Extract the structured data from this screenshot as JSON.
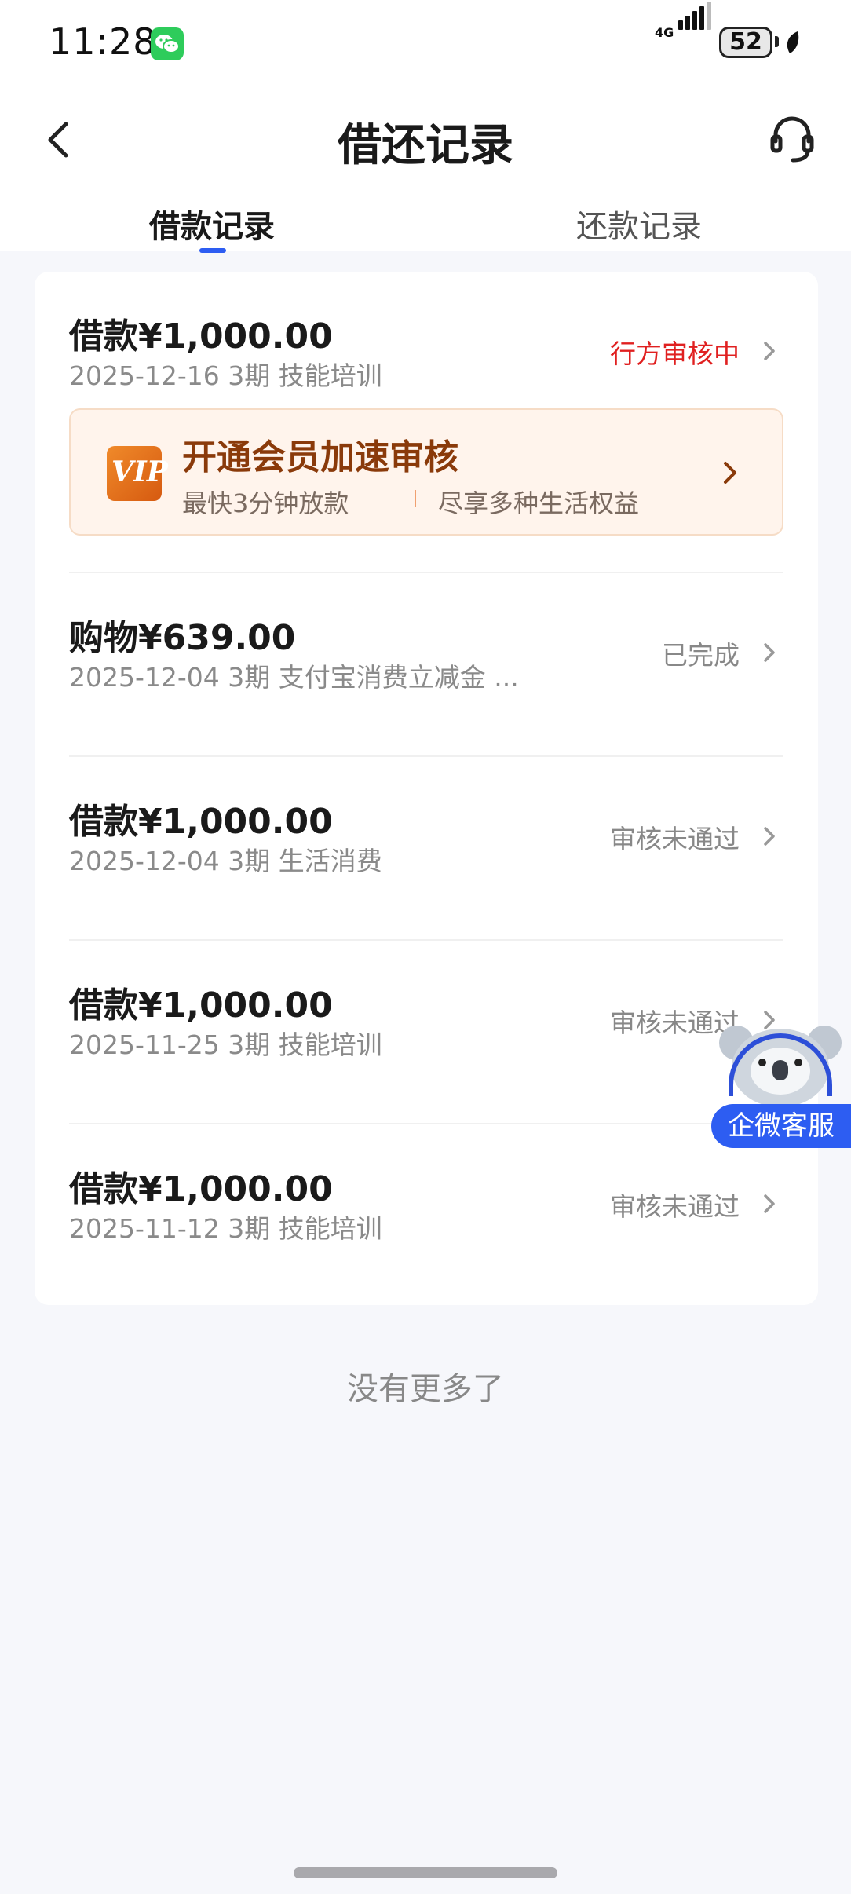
{
  "status_bar": {
    "time": "11:28",
    "network": "4G",
    "battery": "52"
  },
  "header": {
    "title": "借还记录",
    "back_icon": "chevron-left-icon",
    "service_icon": "headset-icon"
  },
  "tabs": [
    {
      "label": "借款记录",
      "active": true
    },
    {
      "label": "还款记录",
      "active": false
    }
  ],
  "vip_banner": {
    "title": "开通会员加速审核",
    "subtitle_left": "最快3分钟放款",
    "subtitle_right": "尽享多种生活权益",
    "badge": "VIP"
  },
  "records": [
    {
      "amount": "借款¥1,000.00",
      "meta": "2025-12-16 3期  技能培训",
      "status": "行方审核中",
      "status_color": "#e02020"
    },
    {
      "amount": "购物¥639.00",
      "meta": "2025-12-04 3期  支付宝消费立减金 ...",
      "status": "已完成",
      "status_color": "#888888"
    },
    {
      "amount": "借款¥1,000.00",
      "meta": "2025-12-04 3期  生活消费",
      "status": "审核未通过",
      "status_color": "#888888"
    },
    {
      "amount": "借款¥1,000.00",
      "meta": "2025-11-25 3期  技能培训",
      "status": "审核未通过",
      "status_color": "#888888"
    },
    {
      "amount": "借款¥1,000.00",
      "meta": "2025-11-12 3期  技能培训",
      "status": "审核未通过",
      "status_color": "#888888"
    }
  ],
  "footer": {
    "no_more": "没有更多了"
  },
  "floating_service": {
    "label": "企微客服"
  },
  "colors": {
    "accent": "#2d5df2",
    "warning_red": "#e02020",
    "vip_brown": "#8a3a0a"
  }
}
